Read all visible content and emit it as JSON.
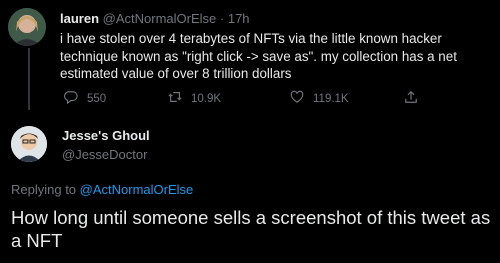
{
  "parent_tweet": {
    "display_name": "lauren",
    "handle": "@ActNormalOrElse",
    "separator": "·",
    "time_ago": "17h",
    "text": "i have stolen over 4 terabytes of NFTs via the little known hacker technique known as \"right click -> save as\". my collection has a net estimated value of over 8 trillion dollars",
    "actions": {
      "replies": "550",
      "retweets": "10.9K",
      "likes": "119.1K"
    }
  },
  "reply_tweet": {
    "display_name": "Jesse's Ghoul",
    "handle": "@JesseDoctor",
    "replying_prefix": "Replying to",
    "replying_to": "@ActNormalOrElse",
    "text": "How long until someone sells a screenshot of this tweet as a NFT"
  },
  "colors": {
    "background": "#000000",
    "primary_text": "#e7e9ea",
    "secondary_text": "#71767b",
    "link": "#1d9bf0"
  },
  "icons": [
    "reply-icon",
    "retweet-icon",
    "like-icon",
    "share-icon"
  ]
}
